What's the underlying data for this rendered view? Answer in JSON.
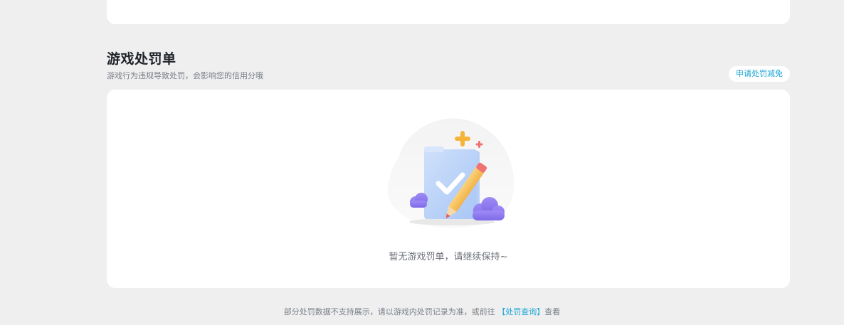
{
  "section": {
    "title": "游戏处罚单",
    "subtitle": "游戏行为违规导致处罚，会影响您的信用分哦",
    "apply_button_label": "申请处罚减免"
  },
  "empty_state": {
    "message": "暂无游戏罚单，请继续保持~"
  },
  "footer": {
    "note_prefix": "部分处罚数据不支持展示，请以游戏内处罚记录为准，或前往",
    "link_label": "【处罚查询】",
    "note_suffix": "查看"
  },
  "colors": {
    "accent": "#1ba6d4",
    "background": "#efefef",
    "card": "#ffffff"
  }
}
